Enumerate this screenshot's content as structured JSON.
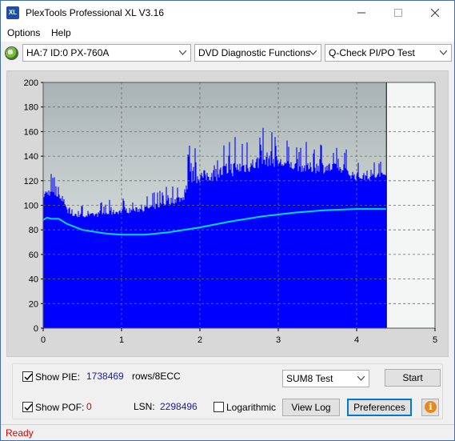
{
  "window": {
    "title": "PlexTools Professional XL V3.16",
    "icon_label": "XL"
  },
  "menu": {
    "items": [
      "Options",
      "Help"
    ]
  },
  "toolbar": {
    "drive": "HA:7 ID:0  PX-760A",
    "function": "DVD Diagnostic Functions",
    "test": "Q-Check PI/PO Test"
  },
  "chart_data": {
    "type": "area",
    "xlim": [
      0,
      5
    ],
    "ylim": [
      0,
      200
    ],
    "x_ticks": [
      "0",
      "1",
      "2",
      "3",
      "4",
      "5"
    ],
    "y_ticks": [
      "0",
      "20",
      "40",
      "60",
      "80",
      "100",
      "120",
      "140",
      "160",
      "180",
      "200"
    ],
    "grid": true,
    "scan_end_x": 4.38,
    "series": [
      {
        "color": "#0000ff",
        "x": [
          0,
          0.1,
          0.2,
          0.28,
          0.32,
          0.4,
          0.6,
          0.8,
          1.0,
          1.2,
          1.4,
          1.6,
          1.8,
          1.85,
          1.9,
          2.0,
          2.2,
          2.4,
          2.6,
          2.8,
          2.9,
          3.0,
          3.2,
          3.4,
          3.6,
          3.8,
          3.9,
          4.0,
          4.2,
          4.38
        ],
        "values": [
          105,
          108,
          105,
          100,
          92,
          90,
          90,
          91,
          93,
          94,
          96,
          100,
          103,
          115,
          117,
          118,
          120,
          123,
          126,
          130,
          132,
          130,
          128,
          126,
          126,
          124,
          122,
          120,
          120,
          122
        ]
      },
      {
        "color": "#0000ff",
        "x": [
          0,
          0.1,
          0.2,
          0.28,
          0.32,
          0.4,
          0.6,
          0.8,
          1.0,
          1.2,
          1.4,
          1.6,
          1.8,
          1.85,
          1.9,
          2.0,
          2.2,
          2.4,
          2.6,
          2.8,
          2.9,
          3.0,
          3.2,
          3.4,
          3.6,
          3.8,
          3.9,
          4.0,
          4.2,
          4.38
        ],
        "values": [
          125,
          128,
          118,
          112,
          100,
          100,
          100,
          104,
          106,
          107,
          110,
          118,
          120,
          155,
          150,
          147,
          150,
          160,
          158,
          165,
          168,
          158,
          150,
          152,
          155,
          150,
          145,
          140,
          138,
          140
        ]
      },
      {
        "color": "#00d8e8",
        "x": [
          0,
          0.05,
          0.1,
          0.2,
          0.3,
          0.5,
          0.8,
          1.0,
          1.3,
          1.6,
          2.0,
          2.4,
          2.8,
          3.2,
          3.6,
          4.0,
          4.38
        ],
        "values": [
          88,
          90,
          89,
          89,
          85,
          80,
          77,
          76,
          76,
          78,
          82,
          87,
          91,
          94,
          96,
          97,
          97
        ]
      }
    ]
  },
  "controls": {
    "show_pie_label": "Show PIE:",
    "pie_value": "1738469",
    "pie_unit": "rows/8ECC",
    "show_pof_label": "Show POF:",
    "pof_value": "0",
    "lsn_label": "LSN:",
    "lsn_value": "2298496",
    "logarithmic_label": "Logarithmic",
    "test_mode": "SUM8 Test",
    "start_label": "Start",
    "view_log_label": "View Log",
    "preferences_label": "Preferences",
    "info_label": "i",
    "show_pie_checked": true,
    "show_pof_checked": true,
    "logarithmic_checked": false
  },
  "status": {
    "text": "Ready"
  },
  "colors": {
    "pie_bar": "#0000ff",
    "po_curve": "#00d8e8",
    "plot_bg_top": "#a9b3b3",
    "plot_bg_bottom": "#eef2f2"
  }
}
